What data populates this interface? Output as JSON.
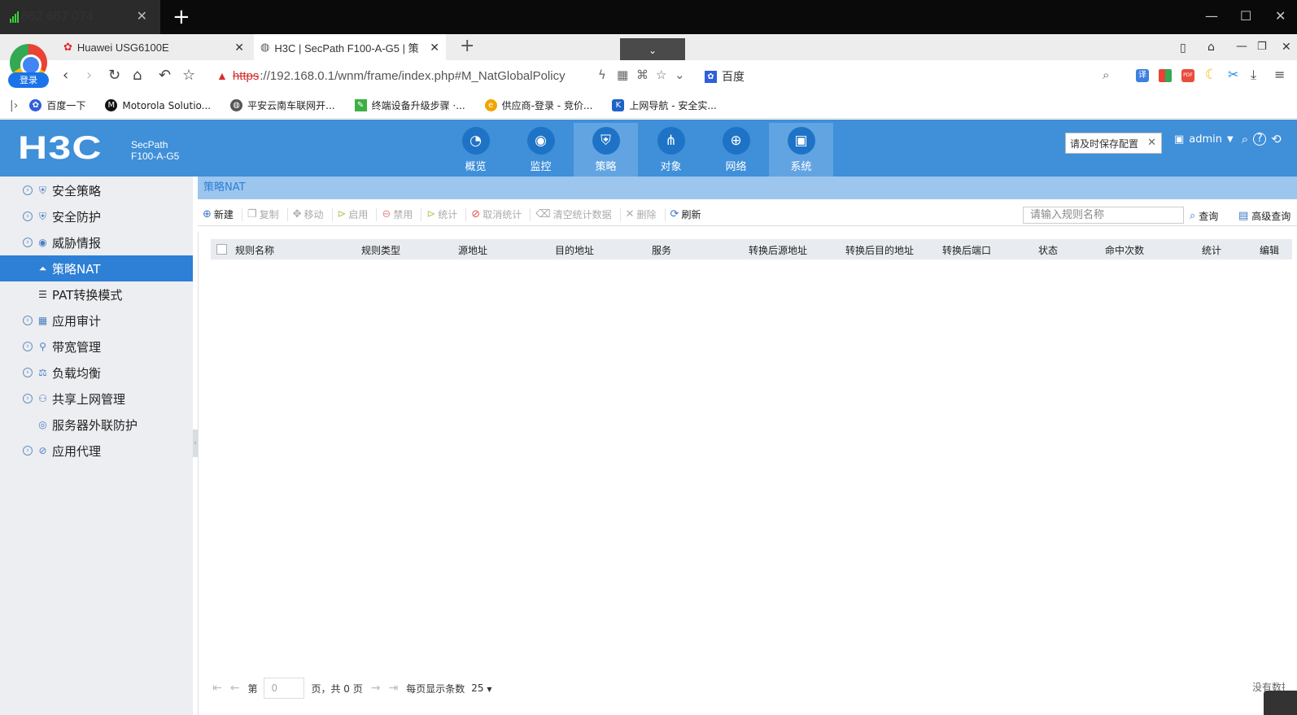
{
  "title_bar": {
    "call_number": "662 687 074"
  },
  "tabs": [
    {
      "label": "Huawei USG6100E"
    },
    {
      "label": "H3C | SecPath F100-A-G5 | 策"
    }
  ],
  "browser": {
    "profile_label": "登录",
    "url_scheme": "https",
    "url_rest": "://192.168.0.1/wnm/frame/index.php#M_NatGlobalPolicy",
    "search_engine": "百度"
  },
  "bookmarks": [
    {
      "label": "百度一下"
    },
    {
      "label": "Motorola Solutio..."
    },
    {
      "label": "平安云南车联网开..."
    },
    {
      "label": "终端设备升级步骤 ·..."
    },
    {
      "label": "供应商-登录 - 竞价..."
    },
    {
      "label": "上网导航 - 安全实..."
    }
  ],
  "header": {
    "logo": "H3C",
    "model_line1": "SecPath",
    "model_line2": "F100-A-G5",
    "nav": [
      {
        "label": "概览",
        "icon": "gauge-icon"
      },
      {
        "label": "监控",
        "icon": "camera-icon"
      },
      {
        "label": "策略",
        "icon": "shield-icon"
      },
      {
        "label": "对象",
        "icon": "share-icon"
      },
      {
        "label": "网络",
        "icon": "globe-icon"
      },
      {
        "label": "系统",
        "icon": "monitor-icon"
      }
    ],
    "save_tip": "请及时保存配置",
    "user": "admin"
  },
  "sidebar": [
    {
      "label": "安全策略"
    },
    {
      "label": "安全防护"
    },
    {
      "label": "威胁情报"
    },
    {
      "label": "策略NAT"
    },
    {
      "label": "PAT转换模式"
    },
    {
      "label": "应用审计"
    },
    {
      "label": "带宽管理"
    },
    {
      "label": "负载均衡"
    },
    {
      "label": "共享上网管理"
    },
    {
      "label": "服务器外联防护"
    },
    {
      "label": "应用代理"
    }
  ],
  "page": {
    "title": "策略NAT",
    "toolbar": {
      "new": "新建",
      "copy": "复制",
      "move": "移动",
      "enable": "启用",
      "disable": "禁用",
      "stats": "统计",
      "cancel_stats": "取消统计",
      "clear_stats": "清空统计数据",
      "delete": "删除",
      "refresh": "刷新"
    },
    "search_placeholder": "请输入规则名称",
    "query": "查询",
    "advanced_query": "高级查询",
    "columns": [
      "规则名称",
      "规则类型",
      "源地址",
      "目的地址",
      "服务",
      "转换后源地址",
      "转换后目的地址",
      "转换后端口",
      "状态",
      "命中次数",
      "统计",
      "编辑"
    ],
    "pager": {
      "page_prefix": "第",
      "page_value": "0",
      "page_suffix": "页，共 0 页",
      "per_page_label": "每页显示条数",
      "per_page_value": "25",
      "no_data": "没有数据"
    }
  }
}
